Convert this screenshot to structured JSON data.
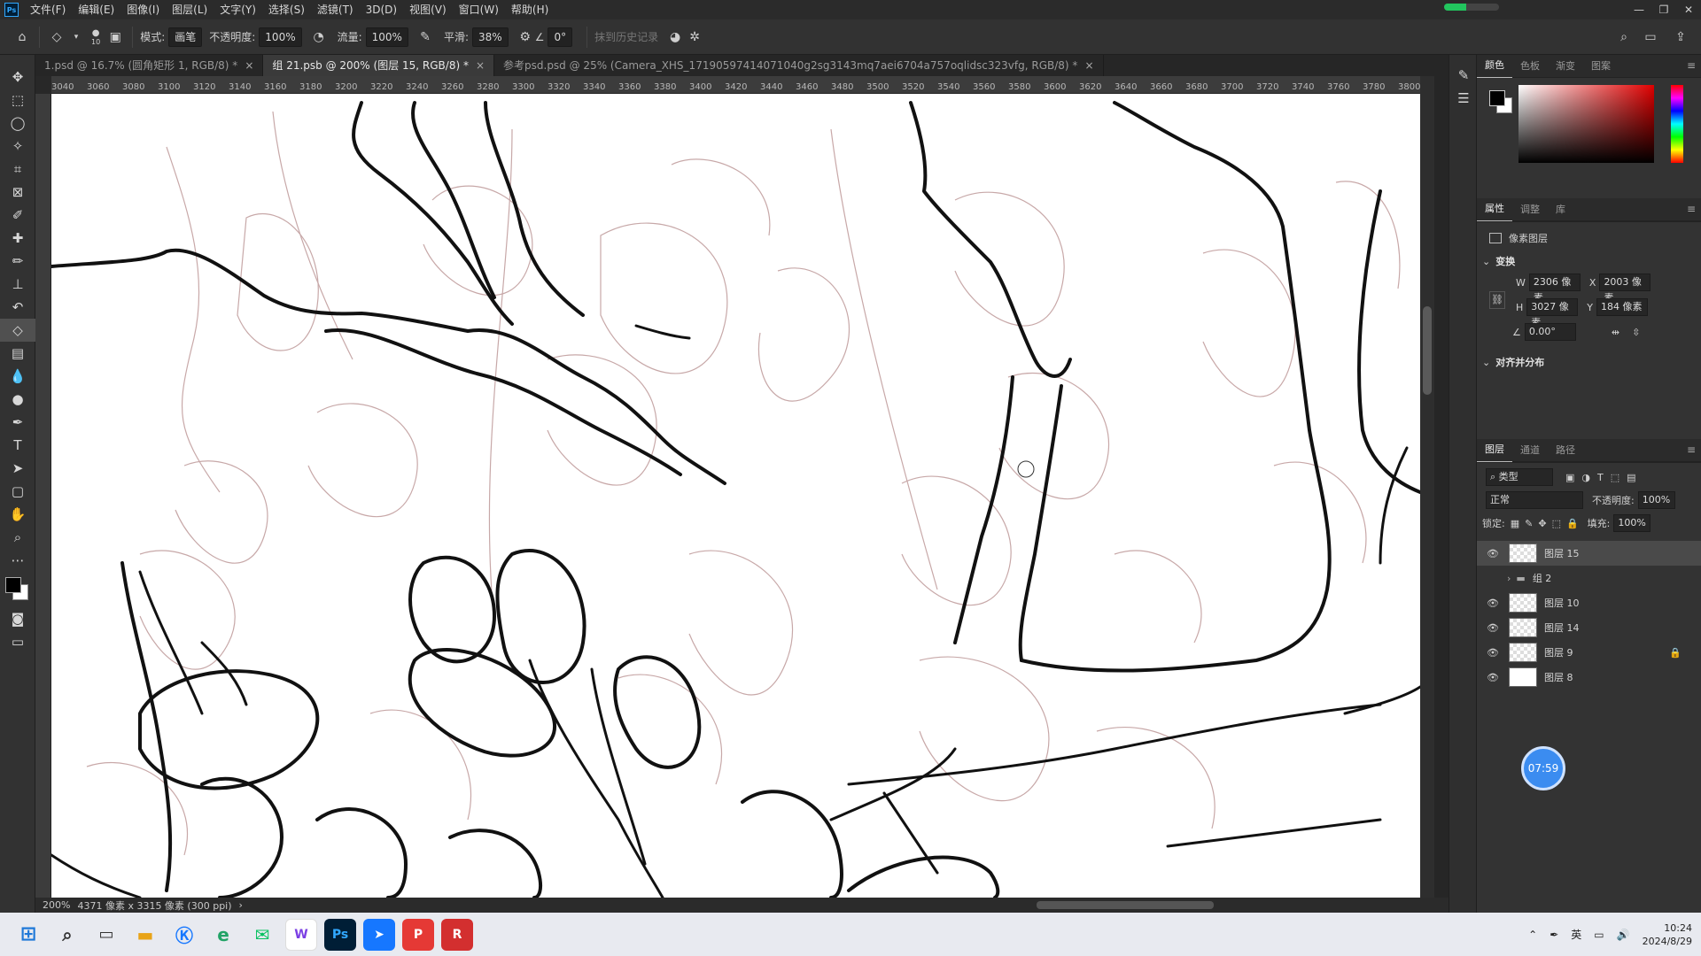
{
  "menu": {
    "items": [
      "文件(F)",
      "编辑(E)",
      "图像(I)",
      "图层(L)",
      "文字(Y)",
      "选择(S)",
      "滤镜(T)",
      "3D(D)",
      "视图(V)",
      "窗口(W)",
      "帮助(H)"
    ],
    "logo": "Ps"
  },
  "options": {
    "brush_size": "10",
    "mode_label": "模式:",
    "mode_value": "画笔",
    "opacity_label": "不透明度:",
    "opacity_value": "100%",
    "flow_label": "流量:",
    "flow_value": "100%",
    "smooth_label": "平滑:",
    "smooth_value": "38%",
    "angle_value": "0°",
    "erase_history_label": "抹到历史记录"
  },
  "tabs": [
    {
      "label": "1.psd @ 16.7% (圆角矩形 1, RGB/8) *",
      "active": false
    },
    {
      "label": "组 21.psb @ 200% (图层 15, RGB/8) *",
      "active": true
    },
    {
      "label": "参考psd.psd @ 25% (Camera_XHS_17190597414071040g2sg3143mq7aei6704a757oqlidsc323vfg, RGB/8) *",
      "active": false
    }
  ],
  "ruler": {
    "ticks": [
      "3040",
      "3060",
      "3080",
      "3100",
      "3120",
      "3140",
      "3160",
      "3180",
      "3200",
      "3220",
      "3240",
      "3260",
      "3280",
      "3300",
      "3320",
      "3340",
      "3360",
      "3380",
      "3400",
      "3420",
      "3440",
      "3460",
      "3480",
      "3500",
      "3520",
      "3540",
      "3560",
      "3580",
      "3600",
      "3620",
      "3640",
      "3660",
      "3680",
      "3700",
      "3720",
      "3740",
      "3760",
      "3780",
      "3800"
    ]
  },
  "status": {
    "zoom": "200%",
    "doc_info": "4371 像素 x 3315 像素 (300 ppi)"
  },
  "color_panel": {
    "tabs": [
      "颜色",
      "色板",
      "渐变",
      "图案"
    ],
    "fg": "#000000",
    "bg": "#ffffff"
  },
  "properties": {
    "tabs": [
      "属性",
      "调整",
      "库"
    ],
    "layer_type": "像素图层",
    "transform_title": "变换",
    "w_label": "W",
    "w_value": "2306 像素",
    "x_label": "X",
    "x_value": "2003 像素",
    "h_label": "H",
    "h_value": "3027 像素",
    "y_label": "Y",
    "y_value": "184 像素",
    "angle_value": "0.00°",
    "align_title": "对齐并分布"
  },
  "layers": {
    "tabs": [
      "图层",
      "通道",
      "路径"
    ],
    "filter_kind": "类型",
    "blend_mode": "正常",
    "opacity_label": "不透明度:",
    "opacity_value": "100%",
    "lock_label": "锁定:",
    "fill_label": "填充:",
    "fill_value": "100%",
    "items": [
      {
        "name": "图层 15",
        "selected": true,
        "visible": true,
        "kind": "pixel"
      },
      {
        "name": "组 2",
        "selected": false,
        "visible": false,
        "kind": "group"
      },
      {
        "name": "图层 10",
        "selected": false,
        "visible": true,
        "kind": "pixel"
      },
      {
        "name": "图层 14",
        "selected": false,
        "visible": true,
        "kind": "pixel"
      },
      {
        "name": "图层 9",
        "selected": false,
        "visible": true,
        "kind": "pixel",
        "locked": true
      },
      {
        "name": "图层 8",
        "selected": false,
        "visible": true,
        "kind": "solid"
      }
    ],
    "timer": "07:59"
  },
  "taskbar": {
    "tray_lang": "英",
    "time": "10:24",
    "date": "2024/8/29"
  },
  "colors": {
    "accent": "#31a8ff",
    "sketch": "#b07878",
    "ink": "#111111"
  }
}
